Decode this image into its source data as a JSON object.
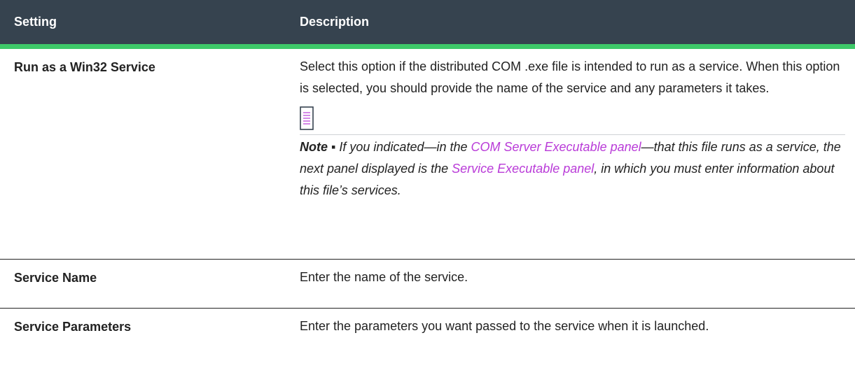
{
  "header": {
    "setting_label": "Setting",
    "description_label": "Description"
  },
  "rows": [
    {
      "setting": "Run as a Win32 Service",
      "description": "Select this option if the distributed COM .exe file is intended to run as a service. When this option is selected, you should provide the name of the service and any parameters it takes.",
      "note": {
        "label": "Note ▪",
        "text_before": " If you indicated—in the ",
        "link1": "COM Server Executable panel",
        "text_middle": "—that this file runs as a service, the next panel displayed is the ",
        "link2": "Service Executable panel",
        "text_after": ", in which you must enter information about this file’s services."
      }
    },
    {
      "setting": "Service Name",
      "description": "Enter the name of the service."
    },
    {
      "setting": "Service Parameters",
      "description": "Enter the parameters you want passed to the service when it is launched."
    }
  ],
  "colors": {
    "header_bg": "#36434f",
    "accent": "#3ec969",
    "link": "#b93bd8"
  }
}
